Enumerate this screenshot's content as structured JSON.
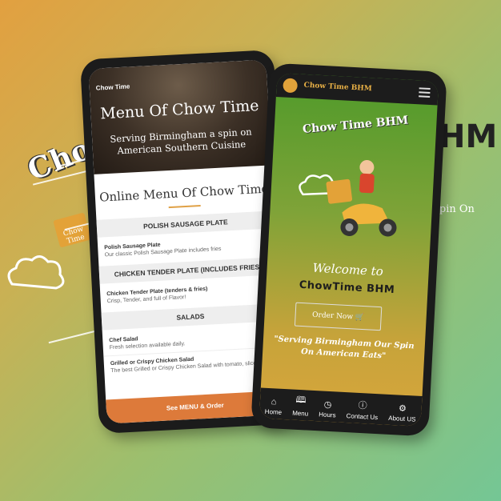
{
  "background": {
    "brand_text": "Chow Time",
    "brand_suffix": "HM",
    "tagline_fragment": "Spin On"
  },
  "phone_menu": {
    "brand": "Chow Time",
    "title": "Menu Of Chow Time",
    "subtitle": "Serving Birmingham a spin on American Southern Cuisine",
    "section_title": "Online Menu Of Chow Time",
    "categories": [
      {
        "name": "POLISH SAUSAGE PLATE",
        "items": [
          {
            "name": "Polish Sausage Plate",
            "desc": "Our classic Polish Sausage Plate includes fries"
          }
        ]
      },
      {
        "name": "CHICKEN TENDER PLATE (INCLUDES FRIES)",
        "items": [
          {
            "name": "Chicken Tender Plate (tenders & fries)",
            "desc": "Crisp, Tender, and full of Flavor!"
          }
        ]
      },
      {
        "name": "SALADS",
        "items": [
          {
            "name": "Chef Salad",
            "desc": "Fresh selection available daily."
          },
          {
            "name": "Grilled or Crispy Chicken Salad",
            "desc": "The best Grilled or Crispy Chicken Salad with tomato, sliced cu"
          }
        ]
      }
    ],
    "cta_button": "See MENU & Order"
  },
  "phone_home": {
    "header_logo": "Chow Time BHM",
    "logo_arc": "Chow Time BHM",
    "welcome": "Welcome to",
    "business_name": "ChowTime BHM",
    "order_button": "Order Now 🛒",
    "quote": "\"Serving Birmingham Our Spin On American Eats\"",
    "nav": [
      {
        "label": "Home",
        "icon": "home-icon"
      },
      {
        "label": "Menu",
        "icon": "book-icon"
      },
      {
        "label": "Hours",
        "icon": "clock-icon"
      },
      {
        "label": "Contact Us",
        "icon": "question-icon"
      },
      {
        "label": "About US",
        "icon": "gear-icon"
      }
    ]
  }
}
